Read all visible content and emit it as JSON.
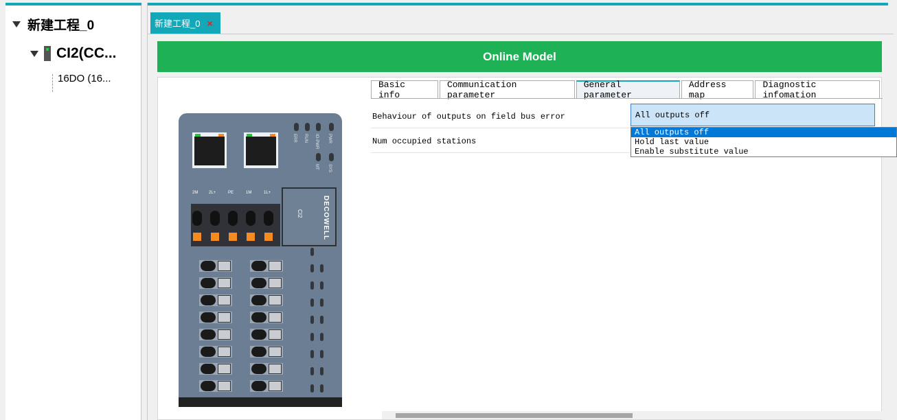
{
  "tree": {
    "project": "新建工程_0",
    "device": "CI2(CC...",
    "module": "16DO (16..."
  },
  "document_tab": {
    "label": "新建工程_0",
    "close": "×"
  },
  "banner": {
    "title": "Online Model"
  },
  "device_image": {
    "brand": "DECOWELL",
    "model": "CI2",
    "led_labels": [
      "ERR",
      "RUN",
      "IO-PWR",
      "PWR",
      "MT",
      "SYS"
    ],
    "terminal_labels": [
      "2M",
      "2L+",
      "PE",
      "1M",
      "1L+"
    ]
  },
  "tabs": [
    {
      "label": "Basic info",
      "active": false
    },
    {
      "label": "Communication parameter",
      "active": false
    },
    {
      "label": "General parameter",
      "active": true
    },
    {
      "label": "Address map",
      "active": false
    },
    {
      "label": "Diagnostic infomation",
      "active": false
    }
  ],
  "parameters": [
    {
      "label": "Behaviour of outputs on field bus error",
      "value": "All outputs off"
    },
    {
      "label": "Num occupied stations",
      "value": ""
    }
  ],
  "dropdown": {
    "options": [
      "All outputs off",
      "Hold last value",
      "Enable substitute value"
    ],
    "selected": "All outputs off"
  },
  "colors": {
    "accent": "#12a8b8",
    "banner": "#1eb155",
    "selection": "#0078d7"
  }
}
